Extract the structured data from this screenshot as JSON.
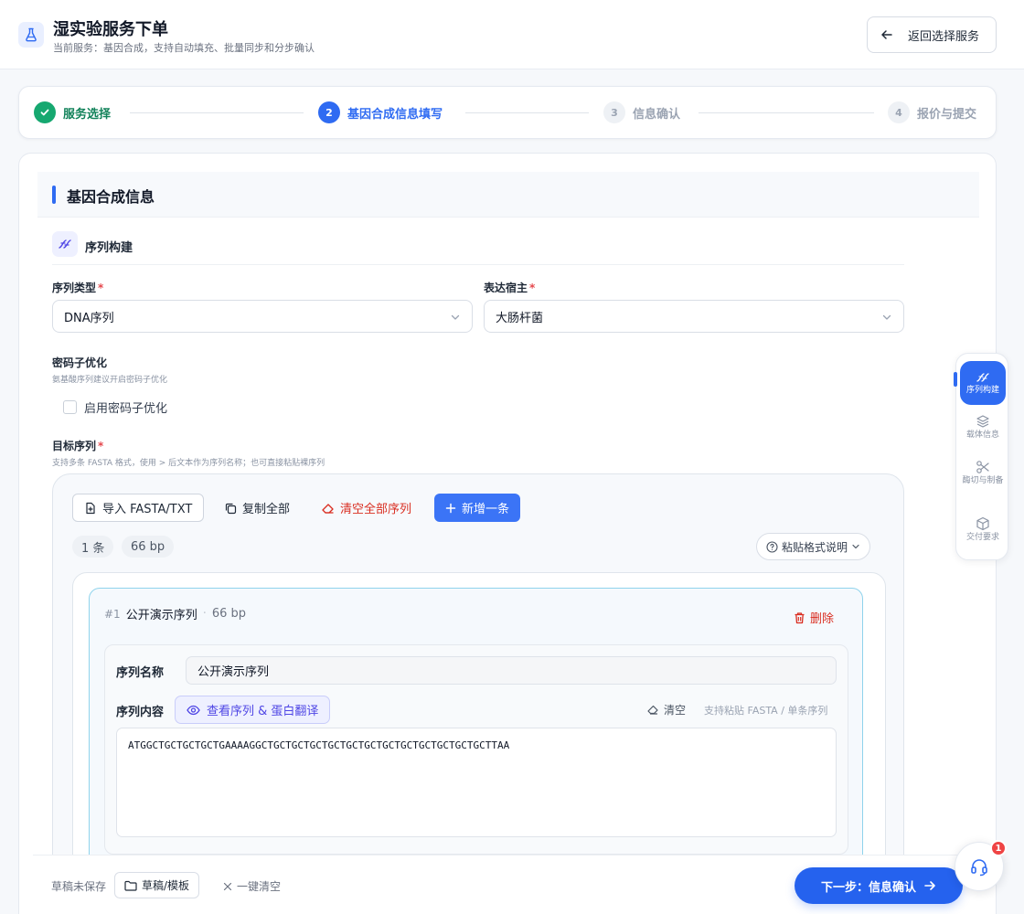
{
  "header": {
    "title": "湿实验服务下单",
    "subtitle": "当前服务：基因合成，支持自动填充、批量同步和分步确认",
    "back_label": "返回选择服务"
  },
  "steps": [
    {
      "index": "1",
      "label": "服务选择",
      "state": "done"
    },
    {
      "index": "2",
      "label": "基因合成信息填写",
      "state": "active"
    },
    {
      "index": "3",
      "label": "信息确认",
      "state": "todo"
    },
    {
      "index": "4",
      "label": "报价与提交",
      "state": "todo"
    }
  ],
  "section": {
    "title": "基因合成信息",
    "subsection_title": "序列构建"
  },
  "form": {
    "seq_type": {
      "label": "序列类型",
      "value": "DNA序列"
    },
    "host": {
      "label": "表达宿主",
      "value": "大肠杆菌"
    },
    "codon": {
      "label": "密码子优化",
      "hint": "氨基酸序列建议开启密码子优化",
      "checkbox_label": "启用密码子优化",
      "checked": false
    },
    "target": {
      "label": "目标序列",
      "hint": "支持多条 FASTA 格式，使用 > 后文本作为序列名称；也可直接粘贴裸序列"
    }
  },
  "toolbar": {
    "import_label": "导入 FASTA/TXT",
    "copy_label": "复制全部",
    "clear_label": "清空全部序列",
    "add_label": "新增一条",
    "count_chip": "1 条",
    "bp_chip": "66 bp",
    "format_label": "粘贴格式说明"
  },
  "sequence_item": {
    "num": "#1",
    "name": "公开演示序列",
    "sep": "·",
    "bp": "66 bp",
    "delete_label": "删除",
    "name_field_label": "序列名称",
    "name_value": "公开演示序列",
    "content_label": "序列内容",
    "view_label": "查看序列 & 蛋白翻译",
    "clear_label": "清空",
    "paste_note": "支持粘贴 FASTA / 单条序列",
    "sequence": "ATGGCTGCTGCTGCTGAAAAGGCTGCTGCTGCTGCTGCTGCTGCTGCTGCTGCTGCTGCTTAA"
  },
  "float_nav": [
    {
      "label": "序列构建",
      "icon": "sequence-icon",
      "active": true
    },
    {
      "label": "载体信息",
      "icon": "layers-icon",
      "active": false
    },
    {
      "label": "酶切与制备",
      "icon": "scissors-icon",
      "active": false
    },
    {
      "label": "交付要求",
      "icon": "box-icon",
      "active": false
    }
  ],
  "bottom": {
    "draft_status": "草稿未保存",
    "draft_btn_label": "草稿/模板",
    "quick_clear_label": "一键清空",
    "next_label": "下一步：信息确认"
  },
  "support": {
    "badge": "1"
  },
  "colors": {
    "primary": "#2f6bf2",
    "success": "#16a870",
    "danger": "#d92d20",
    "accent_purple": "#4f46e5"
  }
}
